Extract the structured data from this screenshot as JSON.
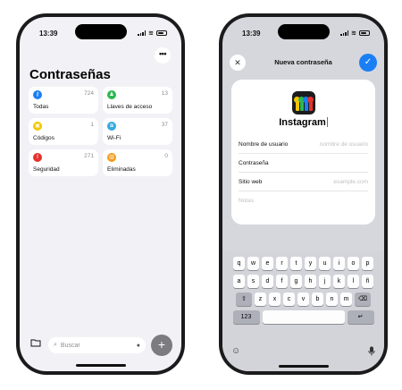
{
  "left": {
    "status_time": "13:39",
    "more_label": "•••",
    "title": "Contraseñas",
    "tiles": [
      {
        "label": "Todas",
        "count": "724",
        "color": "#1a7ff5",
        "icon": "key-icon",
        "glyph": "⚷"
      },
      {
        "label": "Llaves de acceso",
        "count": "13",
        "color": "#30b84f",
        "icon": "person-icon",
        "glyph": "♟"
      },
      {
        "label": "Códigos",
        "count": "1",
        "color": "#f2c500",
        "icon": "lock-icon",
        "glyph": "▣"
      },
      {
        "label": "Wi-Fi",
        "count": "37",
        "color": "#35aadc",
        "icon": "wifi-icon",
        "glyph": "≋"
      },
      {
        "label": "Seguridad",
        "count": "271",
        "color": "#e5322d",
        "icon": "alert-icon",
        "glyph": "!"
      },
      {
        "label": "Eliminadas",
        "count": "0",
        "color": "#f39a1a",
        "icon": "trash-icon",
        "glyph": "▥"
      }
    ],
    "search_placeholder": "Buscar",
    "add_label": "+"
  },
  "right": {
    "status_time": "13:39",
    "sheet_title": "Nueva contraseña",
    "app_name": "Instagram",
    "fields": [
      {
        "label": "Nombre de usuario",
        "placeholder": "nombre de usuario"
      },
      {
        "label": "Contraseña",
        "placeholder": ""
      },
      {
        "label": "Sitio web",
        "placeholder": "example.com"
      }
    ],
    "notes_placeholder": "Notas",
    "keyboard": {
      "row1": [
        "q",
        "w",
        "e",
        "r",
        "t",
        "y",
        "u",
        "i",
        "o",
        "p"
      ],
      "row2": [
        "a",
        "s",
        "d",
        "f",
        "g",
        "h",
        "j",
        "k",
        "l",
        "ñ"
      ],
      "row3": [
        "z",
        "x",
        "c",
        "v",
        "b",
        "n",
        "m"
      ],
      "shift": "⇧",
      "delete": "⌫",
      "numbers": "123",
      "space": "",
      "return": "↵",
      "emoji": "☺",
      "mic": "🎙"
    }
  }
}
